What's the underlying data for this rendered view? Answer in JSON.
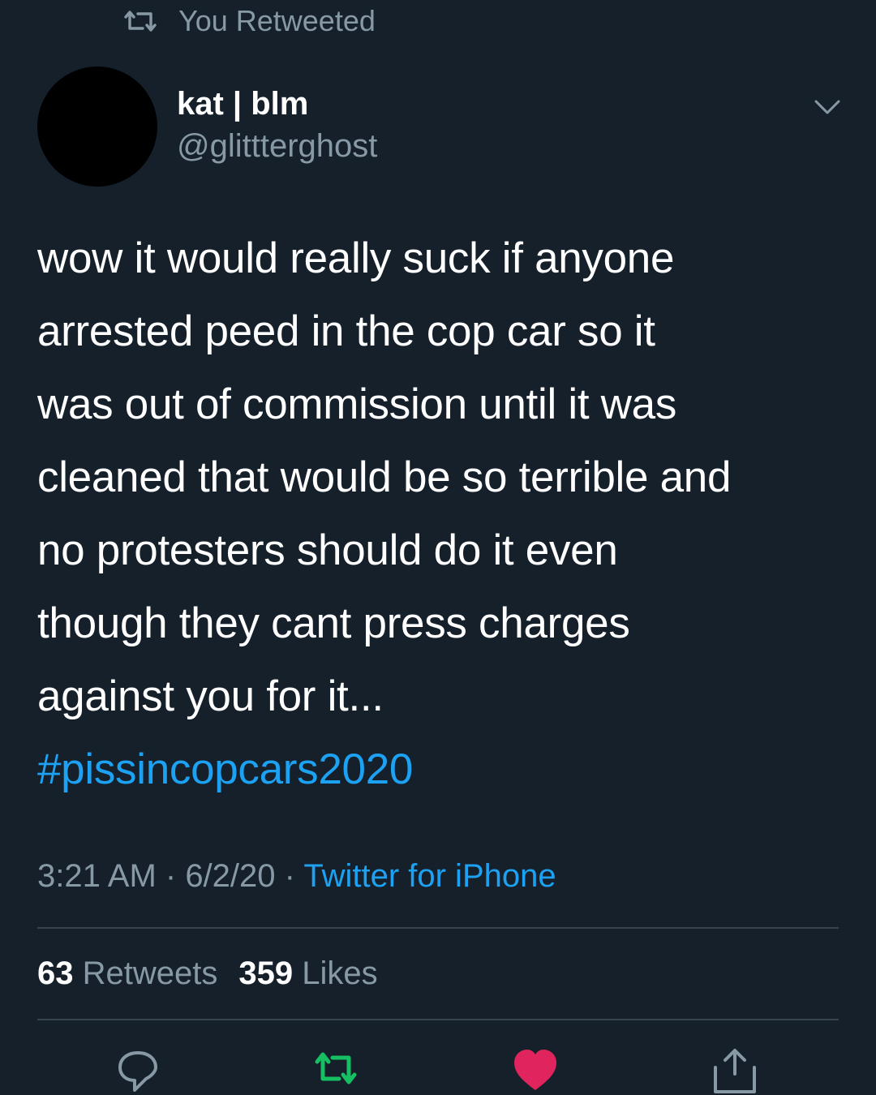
{
  "retweet_context": {
    "label": "You Retweeted",
    "icon": "retweet-icon"
  },
  "author": {
    "display_name": "kat | blm",
    "handle": "@glittterghost",
    "avatar_color": "#000000"
  },
  "tweet": {
    "text_lines": [
      "wow it would really suck if anyone",
      "arrested peed in the cop car so it",
      "was out of commission until it was",
      "cleaned that would be so terrible and",
      "no protesters should do it even",
      "though they cant press charges",
      "against you for it..."
    ],
    "hashtag": "#pissincopcars2020"
  },
  "meta": {
    "time": "3:21 AM",
    "separator": " · ",
    "date": "6/2/20",
    "source": "Twitter for iPhone"
  },
  "stats": {
    "retweets_count": "63",
    "retweets_label": "Retweets",
    "likes_count": "359",
    "likes_label": "Likes"
  },
  "actions": [
    {
      "name": "reply",
      "icon": "reply-icon"
    },
    {
      "name": "retweet",
      "icon": "retweet-icon",
      "active": true,
      "color": "#17bf63"
    },
    {
      "name": "like",
      "icon": "heart-icon",
      "active": true,
      "color": "#e0245e"
    },
    {
      "name": "share",
      "icon": "share-icon"
    }
  ],
  "colors": {
    "background": "#15202b",
    "secondary_text": "#8899a6",
    "link": "#1da1f2",
    "divider": "#38444d"
  }
}
